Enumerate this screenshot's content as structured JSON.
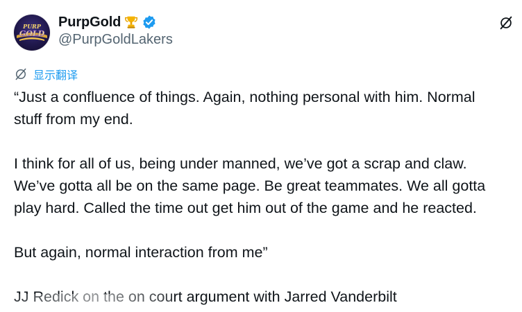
{
  "author": {
    "display_name": "PurpGold",
    "handle": "@PurpGoldLakers",
    "avatar_icon": "purpgold-logo",
    "badge_icon": "trophy-icon",
    "verified_icon": "verified-badge-icon"
  },
  "actions": {
    "grok_icon": "grok-icon"
  },
  "translate": {
    "label": "显示翻译",
    "icon": "translate-globe-icon",
    "color": "#1d9bf0"
  },
  "tweet": {
    "lines": [
      "“Just a confluence of things. Again, nothing personal with him. Normal",
      "stuff from my end.",
      "I think for all of us, being under manned, we’ve got a scrap and claw.",
      "We’ve gotta all be on the same page. Be great teammates. We all gotta",
      "play hard. Called the time out get him out of the game and he reacted.",
      "But again, normal interaction from me”",
      "JJ Redick on the on court argument with Jarred Vanderbilt"
    ]
  },
  "colors": {
    "text": "#0f1419",
    "secondary": "#536471",
    "accent": "#1d9bf0"
  }
}
